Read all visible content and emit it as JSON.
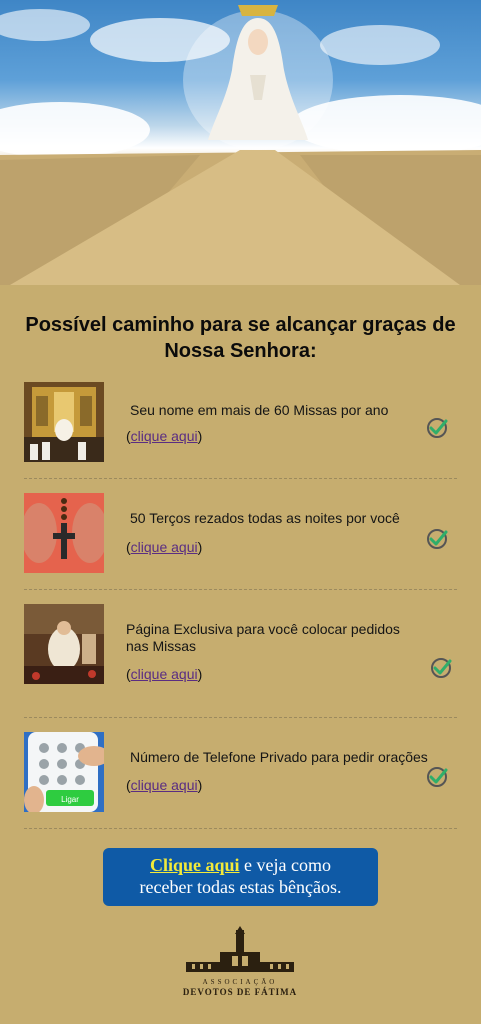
{
  "hero": {
    "image": "our-lady-of-fatima-on-desert-road"
  },
  "title": "Possível caminho para se alcançar graças de Nossa Senhora:",
  "items": [
    {
      "text": "Seu nome em mais de 60 Missas por ano",
      "link_open": "(",
      "link_text": "clique aqui",
      "link_close": ")",
      "thumb": "church-altar-mass"
    },
    {
      "text": "50 Terços rezados todas as noites por você",
      "link_open": "(",
      "link_text": "clique aqui",
      "link_close": ")",
      "thumb": "rosary-crucifix-in-hands"
    },
    {
      "text": "Página Exclusiva para você colocar pedidos nas Missas",
      "link_open": "(",
      "link_text": "clique aqui",
      "link_close": ")",
      "thumb": "priest-at-altar"
    },
    {
      "text": "Número de Telefone Privado para pedir orações",
      "link_open": "(",
      "link_text": "clique aqui",
      "link_close": ")",
      "thumb": "phone-dial-screen"
    }
  ],
  "phone_call_label": "Ligar",
  "cta": {
    "highlight": "Clique aqui",
    "line1_rest": " e veja como",
    "line2": "receber todas estas bênçãos."
  },
  "logo": {
    "line1": "ASSOCIAÇÃO",
    "line2": "DEVOTOS DE FÁTIMA"
  },
  "colors": {
    "background": "#c6ad6f",
    "cta": "#0f5aa6",
    "cta_highlight": "#f3ea3a",
    "check": "#2fae6a",
    "link": "#5a2d82"
  }
}
